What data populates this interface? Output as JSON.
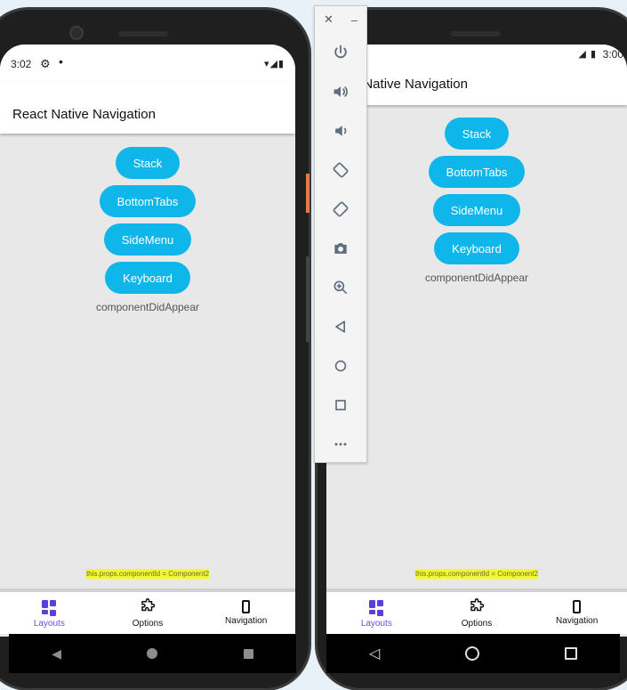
{
  "left_device": {
    "status_bar": {
      "time": "3:02",
      "icons": "▾◢▮"
    },
    "app_bar": {
      "title": "React Native Navigation"
    },
    "buttons": [
      "Stack",
      "BottomTabs",
      "SideMenu",
      "Keyboard"
    ],
    "component_status": "componentDidAppear",
    "component_id_label": "this.props.componentId = Component2",
    "tabs": [
      {
        "label": "Layouts",
        "icon": "grid-icon",
        "active": true
      },
      {
        "label": "Options",
        "icon": "puzzle-icon",
        "active": false
      },
      {
        "label": "Navigation",
        "icon": "phone-icon",
        "active": false
      }
    ]
  },
  "right_device": {
    "status_bar": {
      "time": "3:00",
      "icons": "◢ ▮"
    },
    "app_bar": {
      "title": "React Native Navigation"
    },
    "buttons": [
      "Stack",
      "BottomTabs",
      "SideMenu",
      "Keyboard"
    ],
    "component_status": "componentDidAppear",
    "component_id_label": "this.props.componentId = Component2",
    "tabs": [
      {
        "label": "Layouts",
        "icon": "grid-icon",
        "active": true
      },
      {
        "label": "Options",
        "icon": "puzzle-icon",
        "active": false
      },
      {
        "label": "Navigation",
        "icon": "phone-icon",
        "active": false
      }
    ]
  },
  "emulator_toolbar": {
    "controls": [
      "close-icon",
      "minimize-icon"
    ],
    "items": [
      "power-icon",
      "volume-up-icon",
      "volume-down-icon",
      "rotate-left-icon",
      "rotate-right-icon",
      "camera-icon",
      "zoom-icon",
      "back-icon",
      "home-icon",
      "overview-icon",
      "more-icon"
    ]
  },
  "colors": {
    "accent": "#0fb6ea",
    "tab_active": "#6a4de0",
    "highlight": "#f4f92a"
  }
}
